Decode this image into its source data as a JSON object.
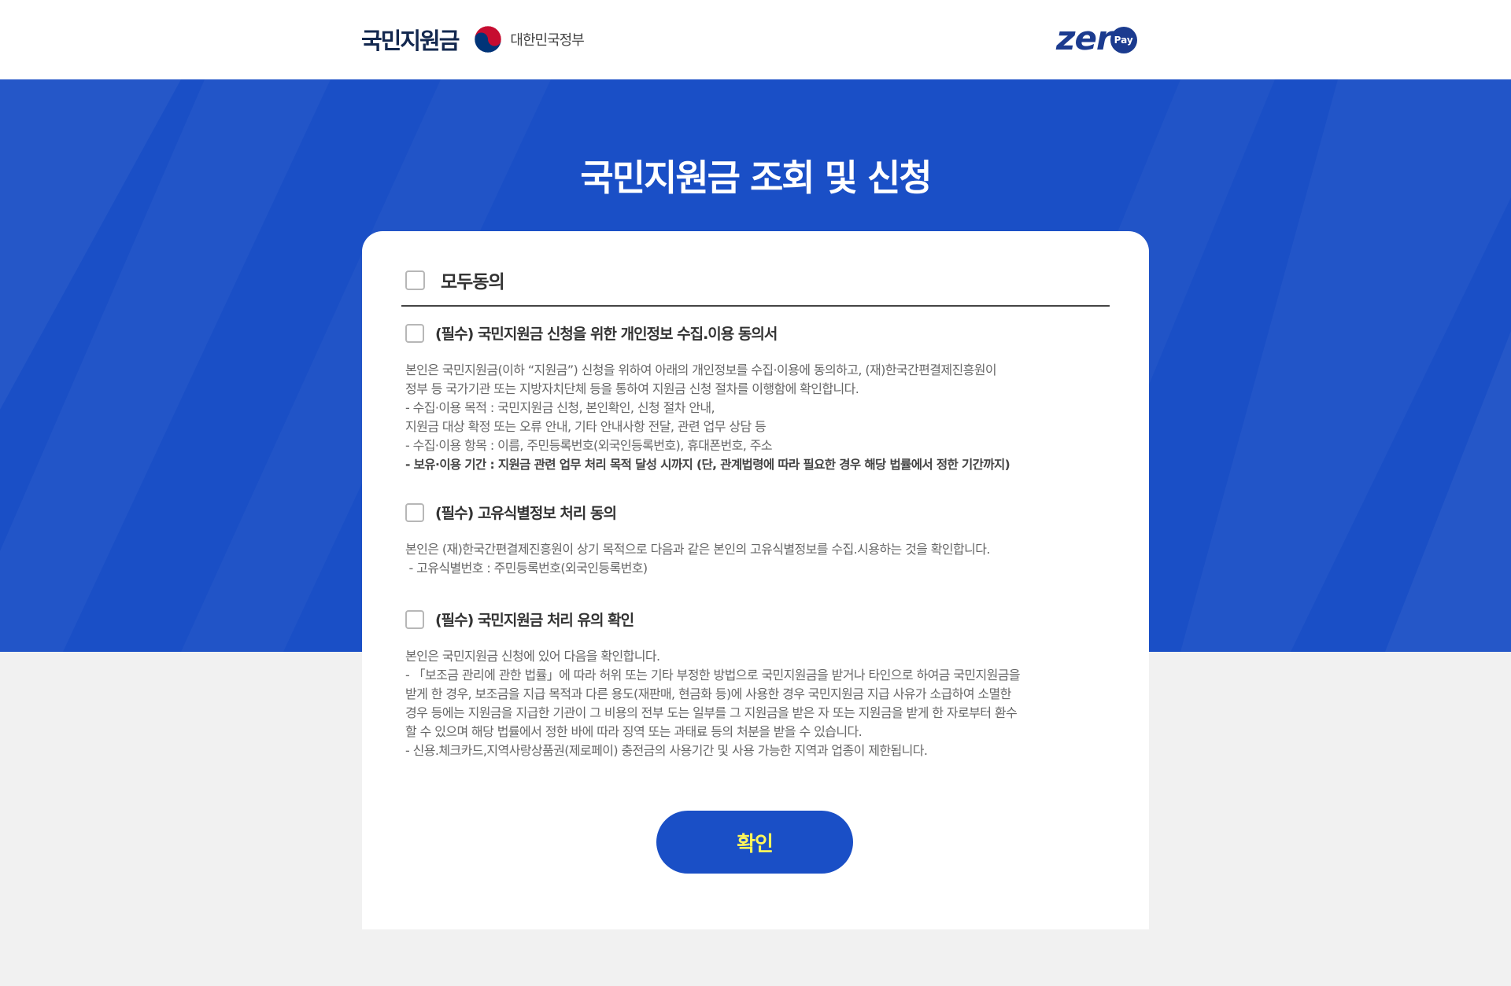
{
  "header": {
    "brand_title": "국민지원금",
    "gov_name": "대한민국정부",
    "zeropay_text": "zer",
    "zeropay_pay": "Pay"
  },
  "hero": {
    "title": "국민지원금 조회 및 신청"
  },
  "agree_all": {
    "label": "모두동의"
  },
  "sections": [
    {
      "title": "(필수) 국민지원금 신청을 위한 개인정보 수집.이용 동의서",
      "lines": [
        "본인은 국민지원금(이하 “지원금”) 신청을 위하여 아래의 개인정보를 수집·이용에 동의하고, (재)한국간편결제진흥원이",
        "정부 등 국가기관 또는 지방자치단체 등을 통하여 지원금 신청 절차를 이행함에 확인합니다.",
        "- 수집·이용 목적 : 국민지원금 신청, 본인확인, 신청 절차 안내,",
        "지원금 대상 확정 또는 오류 안내, 기타 안내사항 전달, 관련 업무 상담 등",
        "- 수집·이용 항목 : 이름, 주민등록번호(외국인등록번호), 휴대폰번호, 주소"
      ],
      "bold_line": "- 보유·이용 기간 : 지원금 관련 업무 처리 목적 달성 시까지 (단, 관계법령에 따라 필요한 경우 해당 법률에서 정한 기간까지)"
    },
    {
      "title": "(필수) 고유식별정보 처리 동의",
      "lines": [
        "본인은 (재)한국간편결제진흥원이 상기 목적으로 다음과 같은 본인의 고유식별정보를 수집.시용하는 것을 확인합니다.",
        " - 고유식별번호 : 주민등록번호(외국인등록번호)"
      ]
    },
    {
      "title": "(필수) 국민지원금 처리 유의 확인",
      "lines": [
        "본인은 국민지원금 신청에 있어 다음을 확인합니다.",
        "- 「보조금 관리에 관한 법률」에 따라 허위 또는 기타 부정한 방법으로 국민지원금을 받거나 타인으로 하여금 국민지원금을",
        "받게 한 경우, 보조금을 지급 목적과 다른 용도(재판매, 현금화 등)에 사용한 경우 국민지원금 지급 사유가 소급하여 소멸한",
        "경우 등에는 지원금을 지급한 기관이 그 비용의 전부 도는 일부를 그 지원금을 받은 자 또는 지원금을 받게 한 자로부터 환수",
        "할 수 있으며 해당 법률에서 정한 바에 따라 징역 또는 과태료 등의 처분을 받을 수 있습니다.",
        "- 신용.체크카드,지역사랑상품권(제로페이) 충전금의 사용기간 및 사용 가능한 지역과 업종이 제한됩니다."
      ]
    }
  ],
  "confirm_button": {
    "label": "확인"
  },
  "colors": {
    "primary_blue": "#1a4fc6",
    "button_text_yellow": "#fff55a",
    "brand_navy": "#1b3b8f"
  }
}
